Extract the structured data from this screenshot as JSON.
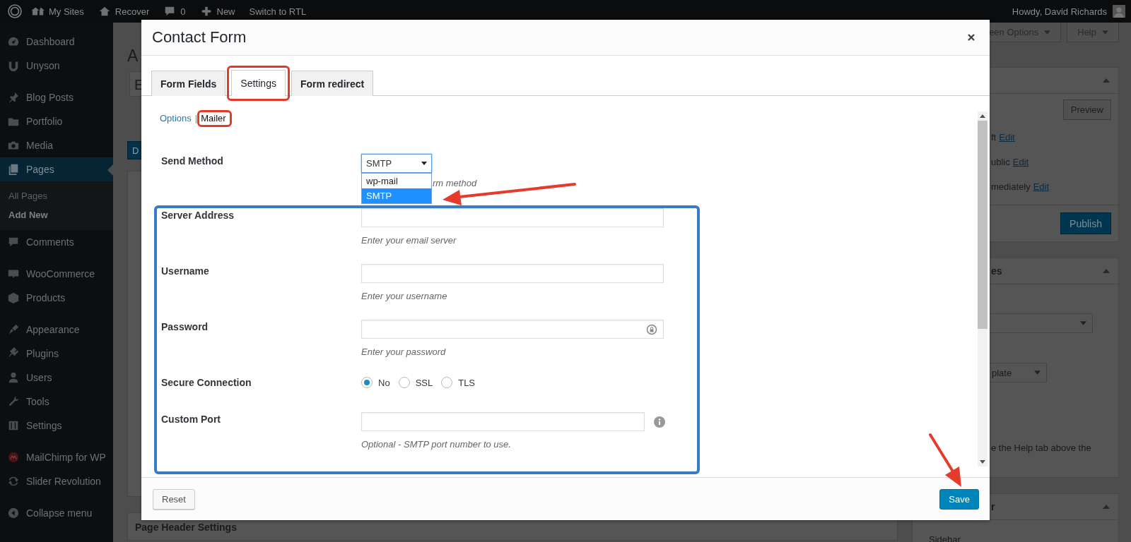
{
  "admin_bar": {
    "items": [
      {
        "label": "My Sites"
      },
      {
        "label": "Recover"
      },
      {
        "label": "0"
      },
      {
        "label": "New"
      },
      {
        "label": "Switch to RTL"
      }
    ],
    "greeting": "Howdy, David Richards"
  },
  "menu": {
    "groups": [
      [
        {
          "label": "Dashboard",
          "selected": false
        },
        {
          "label": "Unyson",
          "selected": false
        }
      ],
      [
        {
          "label": "Blog Posts",
          "selected": false
        },
        {
          "label": "Portfolio",
          "selected": false
        },
        {
          "label": "Media",
          "selected": false
        },
        {
          "label": "Pages",
          "selected": true,
          "children": [
            {
              "label": "All Pages",
              "selected": false
            },
            {
              "label": "Add New",
              "selected": true
            }
          ]
        },
        {
          "label": "Comments",
          "selected": false
        }
      ],
      [
        {
          "label": "WooCommerce",
          "selected": false
        },
        {
          "label": "Products",
          "selected": false
        }
      ],
      [
        {
          "label": "Appearance",
          "selected": false
        },
        {
          "label": "Plugins",
          "selected": false
        },
        {
          "label": "Users",
          "selected": false
        },
        {
          "label": "Tools",
          "selected": false
        },
        {
          "label": "Settings",
          "selected": false
        }
      ],
      [
        {
          "label": "MailChimp for WP",
          "selected": false
        },
        {
          "label": "Slider Revolution",
          "selected": false
        }
      ]
    ],
    "collapse": "Collapse menu"
  },
  "background": {
    "heading": "A",
    "title_field": "E",
    "button": "D",
    "header_box": "Page Header Settings",
    "screen_options": "een Options",
    "help": "Help",
    "publish_box": {
      "preview": "Preview",
      "rows": [
        {
          "text": "ft",
          "link": "Edit"
        },
        {
          "text": "ublic",
          "link": "Edit"
        },
        {
          "text": "mediately",
          "link": "Edit"
        }
      ],
      "publish": "Publish"
    },
    "attributes_box": {
      "title": "es",
      "template_select": "plate",
      "help_text": "e the Help tab above the"
    },
    "sidebar_box": {
      "title": "r",
      "label": "Sidebar"
    }
  },
  "modal": {
    "title": "Contact Form",
    "tabs": [
      {
        "label": "Form Fields",
        "selected": false
      },
      {
        "label": "Settings",
        "selected": true
      },
      {
        "label": "Form redirect",
        "selected": false
      }
    ],
    "subnav": [
      {
        "label": "Options",
        "selected": false
      },
      {
        "label": "Mailer",
        "selected": true
      }
    ],
    "subnav_separator": "|",
    "send_method": {
      "label": "Send Method",
      "value": "SMTP",
      "expanded": true,
      "options": [
        {
          "label": "wp-mail",
          "selected": false
        },
        {
          "label": "SMTP",
          "selected": true
        }
      ],
      "help": "rm method"
    },
    "fields": [
      {
        "kind": "text",
        "label": "Server Address",
        "help": "Enter your email server"
      },
      {
        "kind": "text",
        "label": "Username",
        "help": "Enter your username"
      },
      {
        "kind": "password",
        "label": "Password",
        "help": "Enter your password"
      },
      {
        "kind": "radio",
        "label": "Secure Connection",
        "options": [
          {
            "label": "No",
            "selected": true
          },
          {
            "label": "SSL",
            "selected": false
          },
          {
            "label": "TLS",
            "selected": false
          }
        ]
      },
      {
        "kind": "text",
        "label": "Custom Port",
        "help": "Optional - SMTP port number to use.",
        "info": true
      }
    ],
    "reset": "Reset",
    "save": "Save"
  }
}
